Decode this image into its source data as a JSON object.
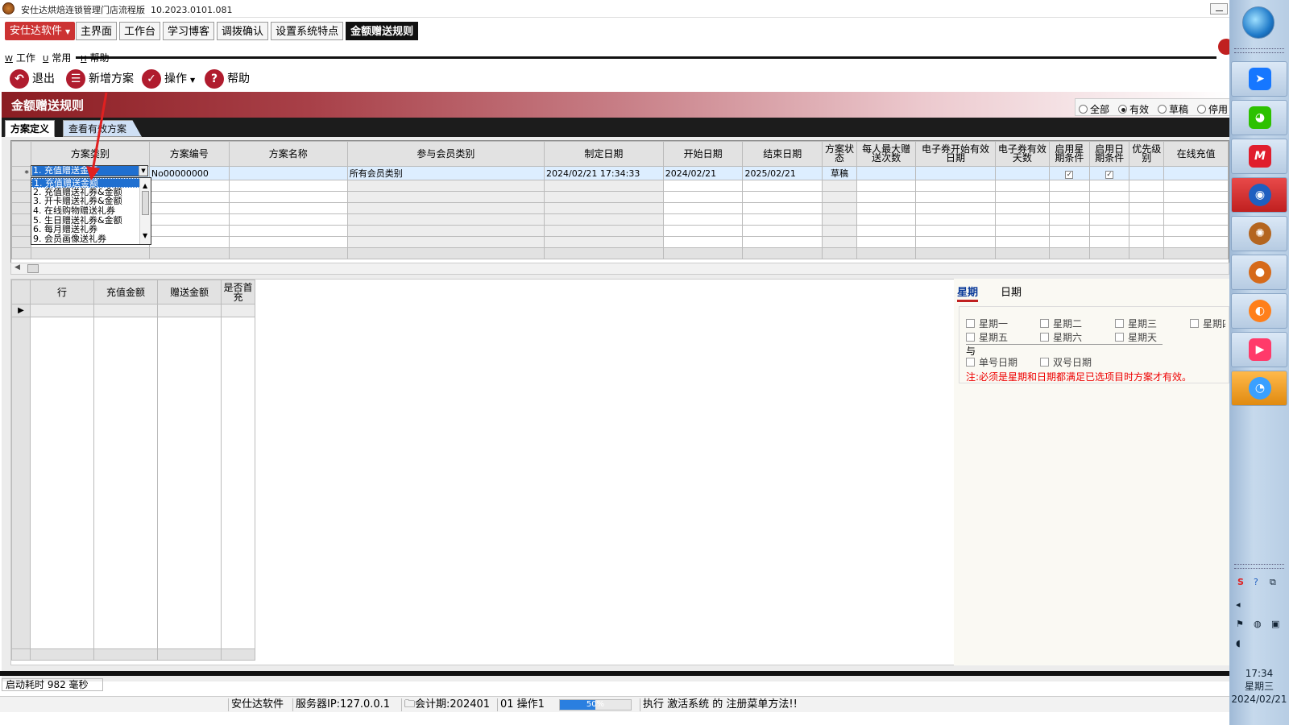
{
  "window": {
    "title": "安仕达烘焙连锁管理门店流程版",
    "version": "10.2023.0101.081"
  },
  "brand_button": "安仕达软件",
  "tabs": [
    {
      "label": "主界面",
      "active": false
    },
    {
      "label": "工作台",
      "active": false
    },
    {
      "label": "学习博客",
      "active": false
    },
    {
      "label": "调拨确认",
      "active": false
    },
    {
      "label": "设置系统特点",
      "active": false
    },
    {
      "label": "金额赠送规则",
      "active": true
    }
  ],
  "menu": [
    {
      "key": "W",
      "label": "工作"
    },
    {
      "key": "U",
      "label": "常用"
    },
    {
      "key": "H",
      "label": "帮助"
    }
  ],
  "toolbar": {
    "exit": "退出",
    "new_plan": "新增方案",
    "operate": "操作",
    "help": "帮助"
  },
  "banner_title": "金额赠送规则",
  "filter": {
    "options": [
      "全部",
      "有效",
      "草稿",
      "停用"
    ],
    "selected": "有效"
  },
  "subtabs": [
    "方案定义",
    "查看有效方案"
  ],
  "plan_grid": {
    "columns": [
      "方案类别",
      "方案编号",
      "方案名称",
      "参与会员类别",
      "制定日期",
      "开始日期",
      "结束日期",
      "方案状态",
      "每人最大赠送次数",
      "电子券开始有效日期",
      "电子券有效天数",
      "启用星期条件",
      "启用日期条件",
      "优先级别",
      "在线充值"
    ],
    "row": {
      "indicator": "*",
      "category": "1. 充值赠送金额",
      "code": "No00000000",
      "name": "",
      "member_type": "所有会员类别",
      "created": "2024/02/21 17:34:33",
      "start": "2024/02/21",
      "end": "2025/02/21",
      "status": "草稿",
      "week_condition": true,
      "date_condition": true
    }
  },
  "category_dropdown": {
    "options": [
      "1. 充值赠送金额",
      "2. 充值赠送礼券&金额",
      "3. 开卡赠送礼券&金额",
      "4. 在线购物赠送礼券",
      "5. 生日赠送礼券&金额",
      "6. 每月赠送礼券",
      "9. 会员画像送礼券"
    ],
    "selected_index": 0
  },
  "detail_grid": {
    "columns": [
      "行",
      "充值金额",
      "赠送金额",
      "是否首充"
    ]
  },
  "right_panel": {
    "tabs": [
      "星期",
      "日期"
    ],
    "active_tab": "星期",
    "weekdays": [
      "星期一",
      "星期二",
      "星期三",
      "星期四",
      "星期五",
      "星期六",
      "星期天"
    ],
    "and_label": "与",
    "odd_day": "单号日期",
    "even_day": "双号日期",
    "note": "注:必须是星期和日期都满足已选项目时方案才有效。"
  },
  "startup_time": "启动耗时 982 毫秒",
  "status": {
    "company": "安仕达软件",
    "server": "服务器IP:127.0.0.1",
    "period": "会计期:202401",
    "operator": "01 操作1",
    "progress": 50,
    "progress_label": "50%",
    "message": "执行 激活系统 的 注册菜单方法!!"
  },
  "clock": {
    "time": "17:34",
    "weekday": "星期三",
    "date": "2024/02/21"
  },
  "colors": {
    "brand_red": "#c33333",
    "banner_dark": "#8b1d22",
    "selection_blue": "#1f6fd0",
    "note_red": "#ee0000"
  }
}
